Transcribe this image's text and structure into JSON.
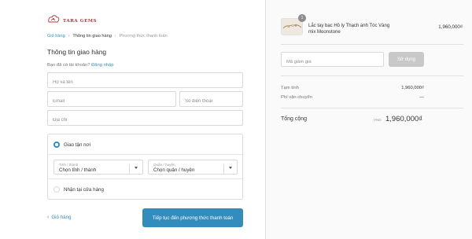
{
  "brand": {
    "name": "TARA GEMS"
  },
  "breadcrumb": {
    "items": [
      "Giỏ hàng",
      "Thông tin giao hàng",
      "Phương thức thanh toán"
    ]
  },
  "shipping_info": {
    "title": "Thông tin giao hàng",
    "login_prompt": "Bạn đã có tài khoản?",
    "login_link": "Đăng nhập"
  },
  "form": {
    "fullname_placeholder": "Họ và tên",
    "email_placeholder": "Email",
    "phone_placeholder": "Số điện thoại",
    "address_placeholder": "Địa chỉ"
  },
  "shipping_methods": {
    "home_delivery": "Giao tận nơi",
    "store_pickup": "Nhận tại cửa hàng",
    "province": {
      "caption": "Tỉnh / thành",
      "value": "Chọn tỉnh / thành"
    },
    "district": {
      "caption": "Quận / huyện",
      "value": "Chọn quận / huyện"
    }
  },
  "actions": {
    "back_label": "Giỏ hàng",
    "continue_label": "Tiếp tục đến phương thức thanh toán"
  },
  "summary": {
    "product": {
      "quantity": "1",
      "name": "Lắc tay bạc Hồ ly Thạch anh Tóc Vàng mix Moonstone",
      "price": "1,960,000₫"
    },
    "discount_placeholder": "Mã giảm giá",
    "use_button": "Sử dụng",
    "subtotal_label": "Tạm tính",
    "subtotal_value": "1,960,000₫",
    "shipping_label": "Phí vận chuyển",
    "shipping_value": "—",
    "total_label": "Tổng cộng",
    "total_currency": "VND",
    "total_value": "1,960,000₫"
  },
  "colors": {
    "accent": "#338dbc",
    "brand": "#b4343a",
    "disabled_button": "#c8c8c8"
  }
}
